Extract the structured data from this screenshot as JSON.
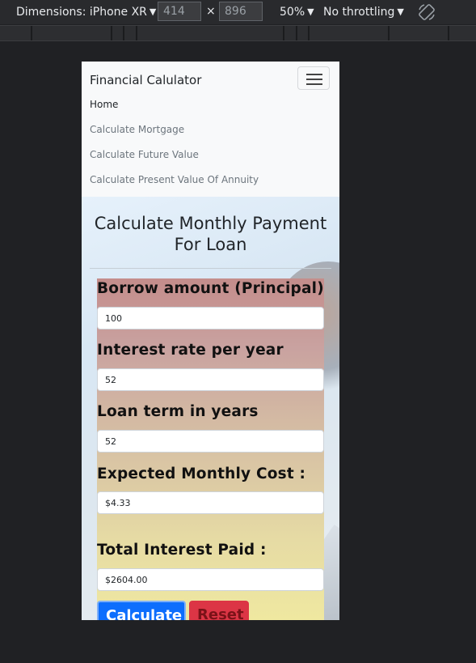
{
  "devtools": {
    "dimensions_label": "Dimensions: iPhone XR",
    "width": "414",
    "height": "896",
    "times": "×",
    "zoom": "50%",
    "throttling": "No throttling"
  },
  "navbar": {
    "brand": "Financial Calulator",
    "links": [
      "Home",
      "Calculate Mortgage",
      "Calculate Future Value",
      "Calculate Present Value Of Annuity"
    ]
  },
  "main": {
    "title": "Calculate Monthly Payment For Loan",
    "fields": [
      {
        "label": "Borrow amount (Principal)",
        "value": "100"
      },
      {
        "label": "Interest rate per year",
        "value": "52"
      },
      {
        "label": "Loan term in years",
        "value": "52"
      }
    ],
    "results": [
      {
        "label": "Expected Monthly Cost :",
        "value": "$4.33"
      },
      {
        "label": "Total Interest Paid :",
        "value": "$2604.00"
      }
    ],
    "calculate_label": "Calculate",
    "reset_label": "Reset"
  },
  "colors": {
    "primary": "#0d6efd",
    "danger": "#dc3545",
    "devtools_bg": "#292a2d"
  }
}
